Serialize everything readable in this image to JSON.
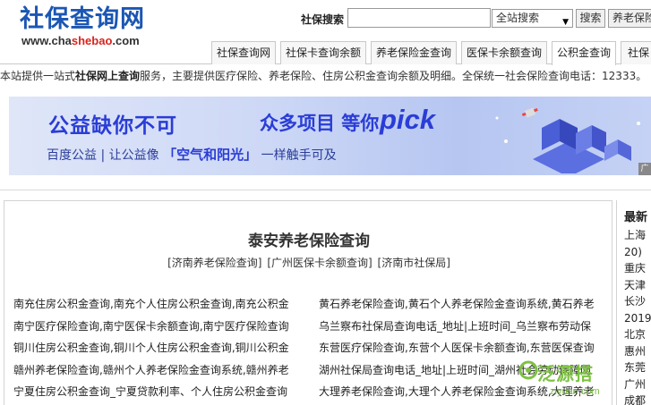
{
  "header": {
    "logo_title": "社保查询网",
    "logo_url_prefix": "www.cha",
    "logo_url_highlight": "shebao",
    "logo_url_suffix": ".com"
  },
  "search": {
    "label": "社保搜索",
    "value": "",
    "scope": "全站搜索",
    "button": "搜索",
    "extra_button": "养老保险"
  },
  "nav": {
    "tabs": [
      "社保查询网",
      "社保卡查询余额",
      "养老保险金查询",
      "医保卡余额查询",
      "公积金查询",
      "社保"
    ]
  },
  "notice": {
    "prefix": "本站提供一站式",
    "bold": "社保网上查询",
    "rest": "服务，主要提供医疗保险、养老保险、住房公积金查询余额及明细。全保统一社会保险查询电话：12333。"
  },
  "banner": {
    "title": "公益缺你不可",
    "tagline": "众多项目 等你",
    "pick": "pick",
    "sub_left": "百度公益 | 让公益像",
    "sub_highlight": "空气和阳光",
    "sub_right": "一样触手可及",
    "ad_mark": "广"
  },
  "main": {
    "title": "泰安养老保险查询",
    "links": [
      "[济南养老保险查询]",
      "[广州医保卡余额查询]",
      "[济南市社保局]"
    ],
    "left_items": [
      "南充住房公积金查询,南充个人住房公积金查询,南充公积金",
      "南宁医疗保险查询,南宁医保卡余额查询,南宁医疗保险查询",
      "铜川住房公积金查询,铜川个人住房公积金查询,铜川公积金",
      "赣州养老保险查询,赣州个人养老保险金查询系统,赣州养老",
      "宁夏住房公积金查询_宁夏贷款利率、个人住房公积金查询"
    ],
    "right_items": [
      "黄石养老保险查询,黄石个人养老保险金查询系统,黄石养老",
      "乌兰察布社保局查询电话_地址|上班时间_乌兰察布劳动保",
      "东营医疗保险查询,东营个人医保卡余额查询,东营医保查询",
      "湖州社保局查询电话_地址|上班时间_湖州社会劳动保障网",
      "大理养老保险查询,大理个人养老保险金查询系统,大理养老"
    ]
  },
  "sidebar": {
    "title": "最新",
    "items": [
      "上海",
      "20)",
      "重庆",
      "天津",
      "长沙",
      "2019",
      "北京",
      "惠州",
      "东莞",
      "广州",
      "成都"
    ]
  },
  "watermark": {
    "text": "泛源搭",
    "url": "ziyuan.com"
  }
}
